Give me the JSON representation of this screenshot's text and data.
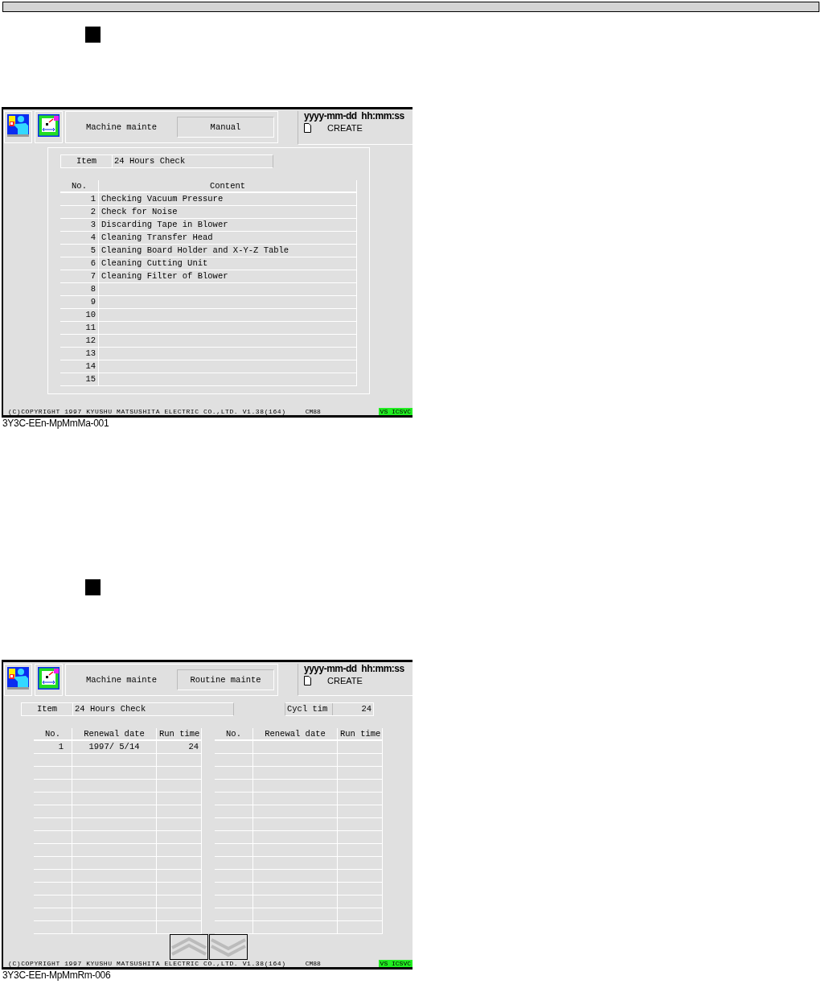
{
  "sections": [
    {
      "kind": "manual",
      "screen": {
        "title": "Machine mainte",
        "mode": "Manual",
        "datetime": "yyyy-mm-dd  hh:mm:ss",
        "file_status": "CREATE",
        "item_label": "Item",
        "item_value": "24 Hours Check",
        "table": {
          "columns": [
            "No.",
            "Content"
          ],
          "rows": [
            {
              "no": "1",
              "content": "Checking Vacuum Pressure"
            },
            {
              "no": "2",
              "content": "Check for Noise"
            },
            {
              "no": "3",
              "content": "Discarding Tape in Blower"
            },
            {
              "no": "4",
              "content": "Cleaning Transfer Head"
            },
            {
              "no": "5",
              "content": "Cleaning Board Holder and X-Y-Z Table"
            },
            {
              "no": "6",
              "content": "Cleaning Cutting Unit"
            },
            {
              "no": "7",
              "content": "Cleaning Filter of Blower"
            },
            {
              "no": "8"
            },
            {
              "no": "9"
            },
            {
              "no": "10"
            },
            {
              "no": "11"
            },
            {
              "no": "12"
            },
            {
              "no": "13"
            },
            {
              "no": "14"
            },
            {
              "no": "15"
            }
          ]
        },
        "copyright": "(C)COPYRIGHT 1997 KYUSHU MATSUSHITA ELECTRIC CO.,LTD. V1.38(164)",
        "machine": "CM88",
        "status_tag": "VS ICSVC"
      },
      "caption": "3Y3C-EEn-MpMmMa-001"
    },
    {
      "kind": "routine",
      "screen": {
        "title": "Machine mainte",
        "mode": "Routine mainte",
        "datetime": "yyyy-mm-dd  hh:mm:ss",
        "file_status": "CREATE",
        "item_label": "Item",
        "item_value": "24 Hours Check",
        "cycle_label": "Cycl tim",
        "cycle_value": "24",
        "tables": [
          {
            "columns": [
              "No.",
              "Renewal date",
              "Run time"
            ],
            "rows": [
              {
                "no": "1",
                "renewal_date": "1997/ 5/14",
                "run_time": "24"
              }
            ]
          },
          {
            "columns": [
              "No.",
              "Renewal date",
              "Run time"
            ]
          }
        ],
        "nav_buttons": [
          {
            "kind": "up"
          },
          {
            "kind": "down"
          }
        ],
        "copyright": "(C)COPYRIGHT 1997 KYUSHU MATSUSHITA ELECTRIC CO.,LTD. V1.38(164)",
        "machine": "CM88",
        "status_tag": "VS ICSVC"
      },
      "caption": "3Y3C-EEn-MpMmRm-006"
    }
  ]
}
